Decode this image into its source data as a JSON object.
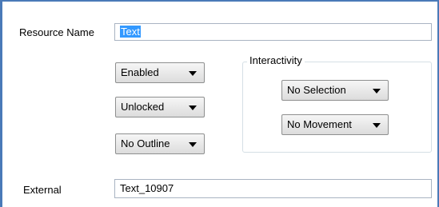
{
  "resource_name": {
    "label": "Resource Name",
    "value": "Text"
  },
  "dropdowns": {
    "enabled": "Enabled",
    "locked": "Unlocked",
    "outline": "No Outline",
    "selection": "No Selection",
    "movement": "No Movement"
  },
  "interactivity": {
    "title": "Interactivity"
  },
  "external": {
    "label": "External",
    "value": "Text_10907"
  },
  "colors": {
    "frame": "#4a7ab8",
    "selection_highlight": "#3399ff"
  }
}
